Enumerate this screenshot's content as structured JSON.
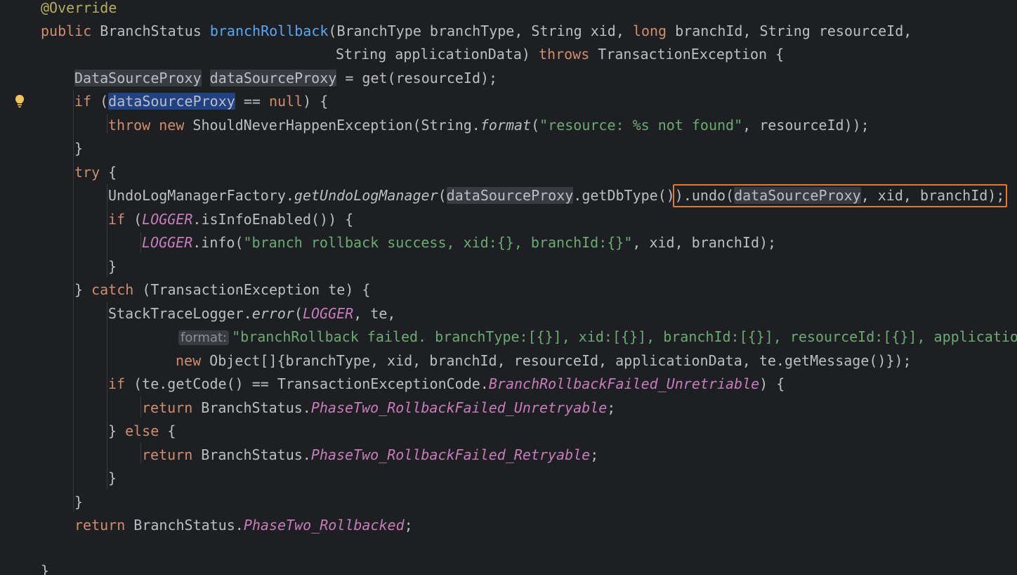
{
  "editor": {
    "language": "java",
    "theme_colors": {
      "background": "#1e1f22",
      "text": "#bcbec4",
      "keyword": "#cf8e6d",
      "annotation": "#b3ae60",
      "method_declaration": "#56a8f5",
      "string": "#6aab73",
      "static_field": "#c77dbb",
      "selection": "#214283",
      "callout_border": "#e8772e"
    },
    "gutter_icon": "lightbulb-icon",
    "inlay_hint": "format:",
    "highlighted_region": ").undo(dataSourceProxy, xid, branchId);",
    "lines": [
      "@Override",
      "public BranchStatus branchRollback(BranchType branchType, String xid, long branchId, String resourceId,",
      "String applicationData) throws TransactionException {",
      "DataSourceProxy dataSourceProxy = get(resourceId);",
      "if (dataSourceProxy == null) {",
      "throw new ShouldNeverHappenException(String.format(\"resource: %s not found\", resourceId));",
      "}",
      "try {",
      "UndoLogManagerFactory.getUndoLogManager(dataSourceProxy.getDbType()).undo(dataSourceProxy, xid, branchId);",
      "if (LOGGER.isInfoEnabled()) {",
      "LOGGER.info(\"branch rollback success, xid:{}, branchId:{}\", xid, branchId);",
      "}",
      "} catch (TransactionException te) {",
      "StackTraceLogger.error(LOGGER, te,",
      "\"branchRollback failed. branchType:[{}], xid:[{}], branchId:[{}], resourceId:[{}], applicatio",
      "new Object[]{branchType, xid, branchId, resourceId, applicationData, te.getMessage()});",
      "if (te.getCode() == TransactionExceptionCode.BranchRollbackFailed_Unretriable) {",
      "return BranchStatus.PhaseTwo_RollbackFailed_Unretryable;",
      "} else {",
      "return BranchStatus.PhaseTwo_RollbackFailed_Retryable;",
      "}",
      "}",
      "return BranchStatus.PhaseTwo_Rollbacked;",
      "",
      "}"
    ]
  }
}
